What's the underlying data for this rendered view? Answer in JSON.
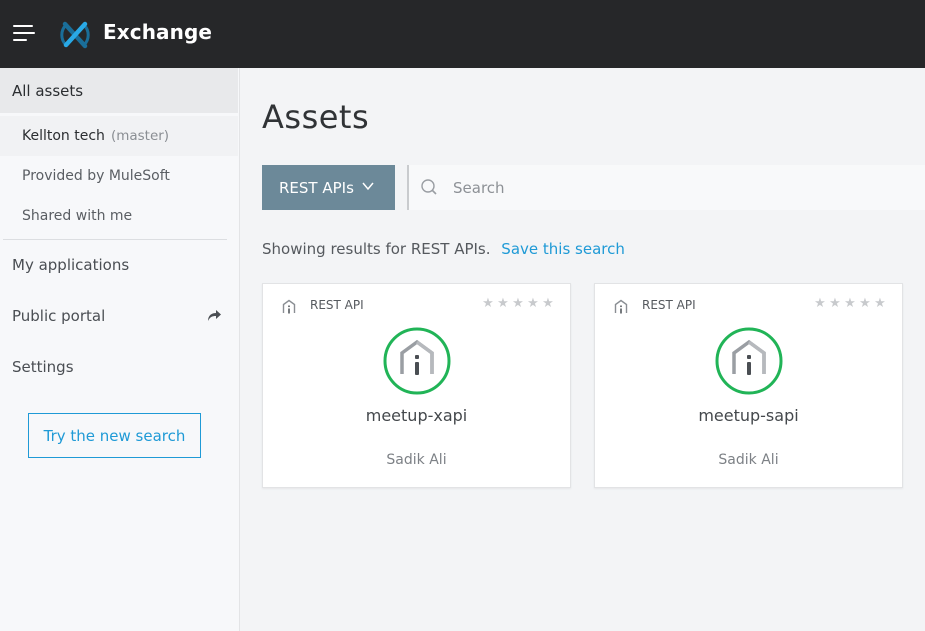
{
  "header": {
    "app_title": "Exchange",
    "menu_icon": "hamburger-menu-icon",
    "logo_icon": "exchange-logo-icon",
    "brand_color": "#1f9ad6",
    "bar_color": "#262729"
  },
  "sidebar": {
    "all_assets": "All assets",
    "sub_items": [
      {
        "label": "Kellton tech",
        "suffix": "(master)"
      },
      {
        "label": "Provided by MuleSoft"
      },
      {
        "label": "Shared with me"
      }
    ],
    "main_items": [
      {
        "label": "My applications"
      },
      {
        "label": "Public portal",
        "icon": "external-share-icon"
      },
      {
        "label": "Settings"
      }
    ],
    "try_button": "Try the new search"
  },
  "main": {
    "title": "Assets",
    "type_filter": {
      "selected": "REST APIs",
      "icon": "chevron-down-icon"
    },
    "search": {
      "placeholder": "Search",
      "value": "",
      "icon": "search-icon"
    },
    "results_text": "Showing results for REST APIs.",
    "save_search_link": "Save this search",
    "cards": [
      {
        "type_label": "REST API",
        "name": "meetup-xapi",
        "owner": "Sadik Ali",
        "rating": 0,
        "max_rating": 5,
        "icon": "rest-api-icon"
      },
      {
        "type_label": "REST API",
        "name": "meetup-sapi",
        "owner": "Sadik Ali",
        "rating": 0,
        "max_rating": 5,
        "icon": "rest-api-icon"
      }
    ],
    "accent_green": "#21b457",
    "filter_color": "#6c8999"
  }
}
